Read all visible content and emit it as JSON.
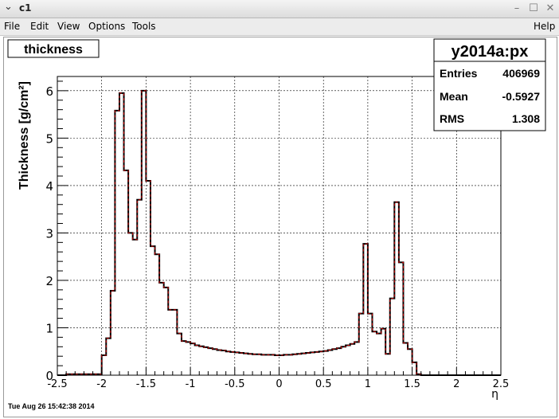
{
  "window": {
    "title": "c1",
    "menu_icon": "chevron-down-icon",
    "buttons": [
      "minimize-icon",
      "maximize-icon",
      "close-icon"
    ]
  },
  "menu": {
    "file": "File",
    "edit": "Edit",
    "view": "View",
    "options": "Options",
    "tools": "Tools",
    "help": "Help"
  },
  "hist_title": "thickness",
  "stats": {
    "name": "y2014a:px",
    "entries_label": "Entries",
    "entries_value": "406969",
    "mean_label": "Mean",
    "mean_value": "-0.5927",
    "rms_label": "RMS",
    "rms_value": "1.308"
  },
  "timestamp": "Tue Aug 26 15:42:38 2014",
  "colors": {
    "line": "#000000",
    "fill_dash": "#cc0000",
    "grid": "#000000"
  },
  "chart_data": {
    "type": "histogram",
    "xlabel": "η",
    "ylabel": "Thickness [g/cm²]",
    "xlim": [
      -2.5,
      2.5
    ],
    "ylim": [
      0,
      6.3
    ],
    "grid": true,
    "x_ticks": [
      -2.5,
      -2,
      -1.5,
      -1,
      -0.5,
      0,
      0.5,
      1,
      1.5,
      2,
      2.5
    ],
    "x_tick_labels": [
      "-2.5",
      "-2",
      "-1.5",
      "-1",
      "-0.5",
      "0",
      "0.5",
      "1",
      "1.5",
      "2",
      "2.5"
    ],
    "y_ticks": [
      0,
      1,
      2,
      3,
      4,
      5,
      6
    ],
    "y_tick_labels": [
      "0",
      "1",
      "2",
      "3",
      "4",
      "5",
      "6"
    ],
    "bin_width": 0.05,
    "bin_start": -2.5,
    "values": [
      0,
      0,
      0.02,
      0.02,
      0.02,
      0.02,
      0.02,
      0.02,
      0.02,
      0.02,
      0.42,
      0.78,
      1.78,
      5.58,
      5.95,
      4.32,
      3.0,
      2.86,
      3.7,
      6.0,
      4.1,
      2.72,
      2.55,
      1.95,
      1.85,
      1.38,
      1.38,
      0.88,
      0.72,
      0.7,
      0.67,
      0.63,
      0.61,
      0.59,
      0.57,
      0.55,
      0.53,
      0.52,
      0.5,
      0.49,
      0.48,
      0.47,
      0.46,
      0.45,
      0.44,
      0.44,
      0.43,
      0.43,
      0.43,
      0.42,
      0.42,
      0.43,
      0.43,
      0.44,
      0.45,
      0.46,
      0.47,
      0.48,
      0.49,
      0.5,
      0.51,
      0.53,
      0.55,
      0.57,
      0.6,
      0.63,
      0.66,
      0.7,
      1.3,
      2.77,
      1.3,
      0.92,
      0.88,
      0.98,
      0.45,
      1.62,
      3.65,
      2.38,
      0.68,
      0.55,
      0.27,
      0.02,
      0,
      0,
      0,
      0,
      0,
      0,
      0,
      0,
      0,
      0,
      0,
      0,
      0,
      0,
      0,
      0,
      0,
      0
    ]
  }
}
